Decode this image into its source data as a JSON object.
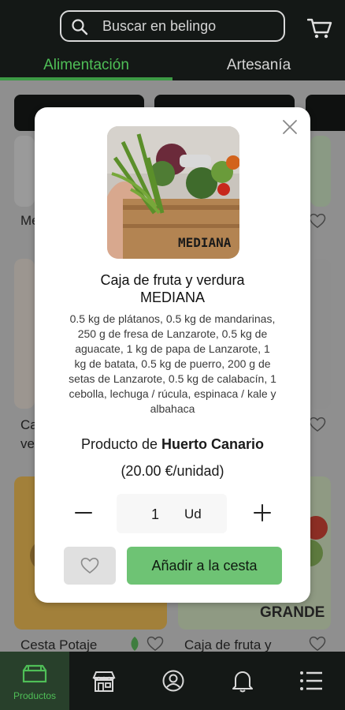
{
  "search": {
    "placeholder": "Buscar en belingo"
  },
  "tabs": [
    {
      "label": "Alimentación"
    },
    {
      "label": "Artesanía"
    }
  ],
  "background_cards": {
    "row1_label": "Me",
    "row2_label_1": "Ca",
    "row2_label_2": "ve",
    "row3_left_label": "Cesta Potaje",
    "row3_right_label": "Caja de fruta y",
    "row3_right_image_tag": "GRANDE"
  },
  "modal": {
    "image_tag": "MEDIANA",
    "title_line1": "Caja de fruta y verdura",
    "title_line2": "MEDIANA",
    "description": "0.5 kg de plátanos, 0.5 kg de mandarinas, 250 g de fresa de Lanzarote, 0.5 kg de aguacate, 1 kg de papa de Lanzarote, 1 kg de batata, 0.5 kg de puerro, 200 g de setas de Lanzarote, 0.5 kg de calabacín, 1 cebolla, lechuga / rúcula, espinaca / kale y albahaca",
    "producer_prefix": "Producto de",
    "producer_name": "Huerto Canario",
    "price": "(20.00 €/unidad)",
    "quantity": "1",
    "unit": "Ud",
    "add_button_label": "Añadir a la cesta"
  },
  "bottom_nav": {
    "active_label": "Productos"
  },
  "colors": {
    "accent": "#4fbf57",
    "add_button": "#6ec374",
    "header_bg": "#141816"
  },
  "icons": [
    "search-icon",
    "cart-icon",
    "close-icon",
    "minus-icon",
    "plus-icon",
    "heart-icon",
    "box-icon",
    "store-icon",
    "user-icon",
    "bell-icon",
    "menu-icon"
  ]
}
